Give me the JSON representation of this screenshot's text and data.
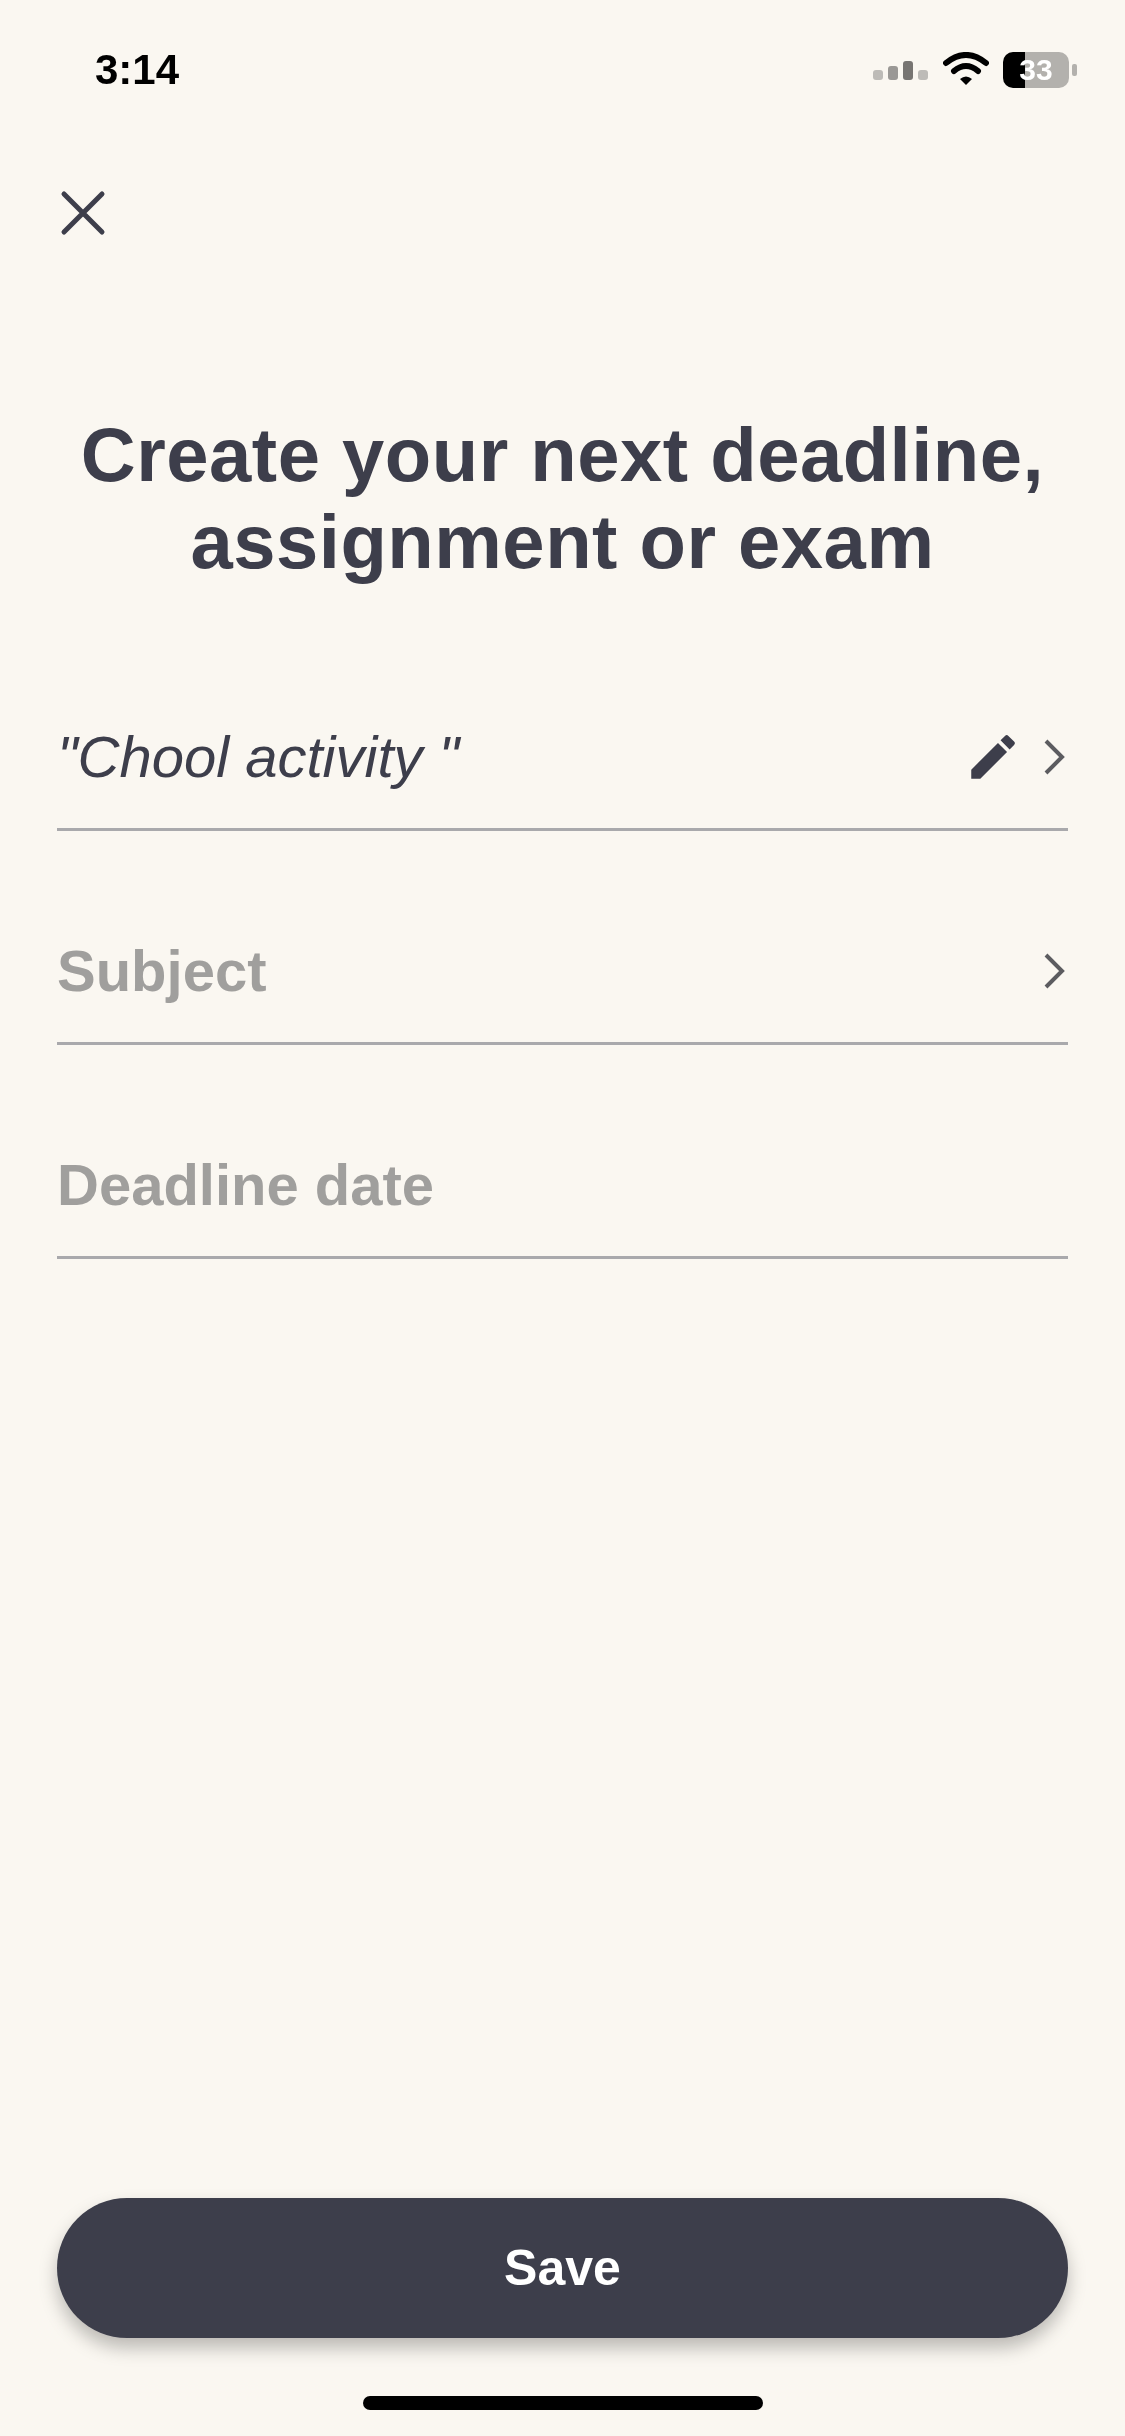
{
  "status_bar": {
    "time": "3:14",
    "battery": "33"
  },
  "title": "Create your next deadline, assignment or exam",
  "fields": [
    {
      "value": "\"Chool activity \"",
      "editable": true,
      "chevron": true
    },
    {
      "placeholder": "Subject",
      "editable": false,
      "chevron": true
    },
    {
      "placeholder": "Deadline date",
      "editable": false,
      "chevron": false
    }
  ],
  "save_button": "Save"
}
